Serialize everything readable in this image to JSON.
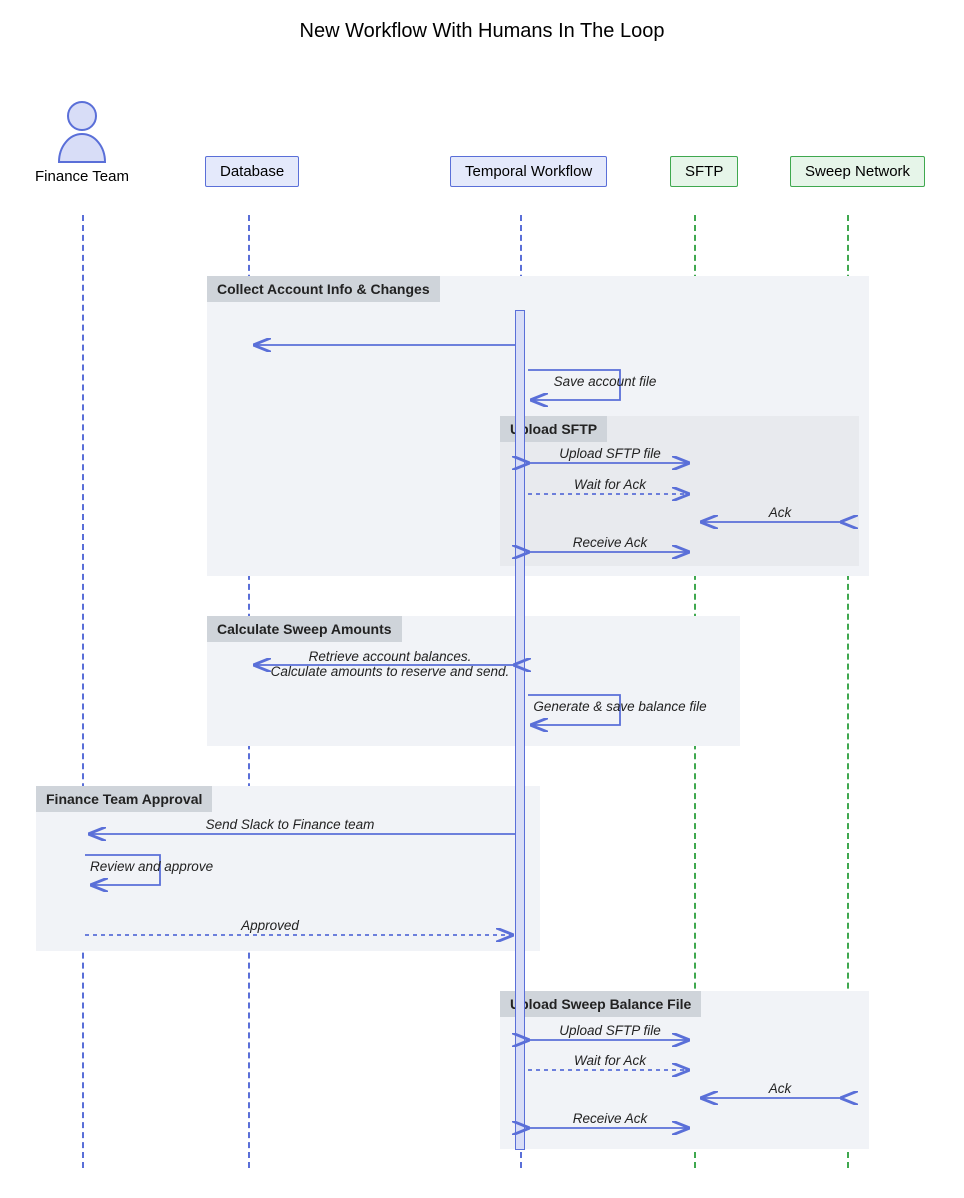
{
  "title": "New Workflow With Humans In The Loop",
  "participants": {
    "financeTeam": "Finance Team",
    "database": "Database",
    "temporal": "Temporal Workflow",
    "sftp": "SFTP",
    "sweep": "Sweep Network"
  },
  "groups": {
    "collect": "Collect Account Info & Changes",
    "uploadSftp": "Upload SFTP",
    "calcSweep": "Calculate Sweep Amounts",
    "approval": "Finance Team Approval",
    "uploadBalance": "Upload Sweep Balance File"
  },
  "messages": {
    "saveAccountFile": "Save account file",
    "uploadSftpFile1": "Upload SFTP file",
    "waitAck1": "Wait for Ack",
    "ack1": "Ack",
    "receiveAck1": "Receive Ack",
    "retrieveBalances": "Retrieve account balances.\nCalculate amounts to reserve and send.",
    "genBalanceFile": "Generate & save balance file",
    "sendSlack": "Send Slack to Finance team",
    "reviewApprove": "Review and approve",
    "approved": "Approved",
    "uploadSftpFile2": "Upload SFTP file",
    "waitAck2": "Wait for Ack",
    "ack2": "Ack",
    "receiveAck2": "Receive Ack"
  },
  "colors": {
    "blue": "#5a6fd8",
    "green": "#3fa84f",
    "groupBg": "#f1f3f7",
    "groupInner": "#e8eaee",
    "groupLabel": "#cfd4da"
  }
}
